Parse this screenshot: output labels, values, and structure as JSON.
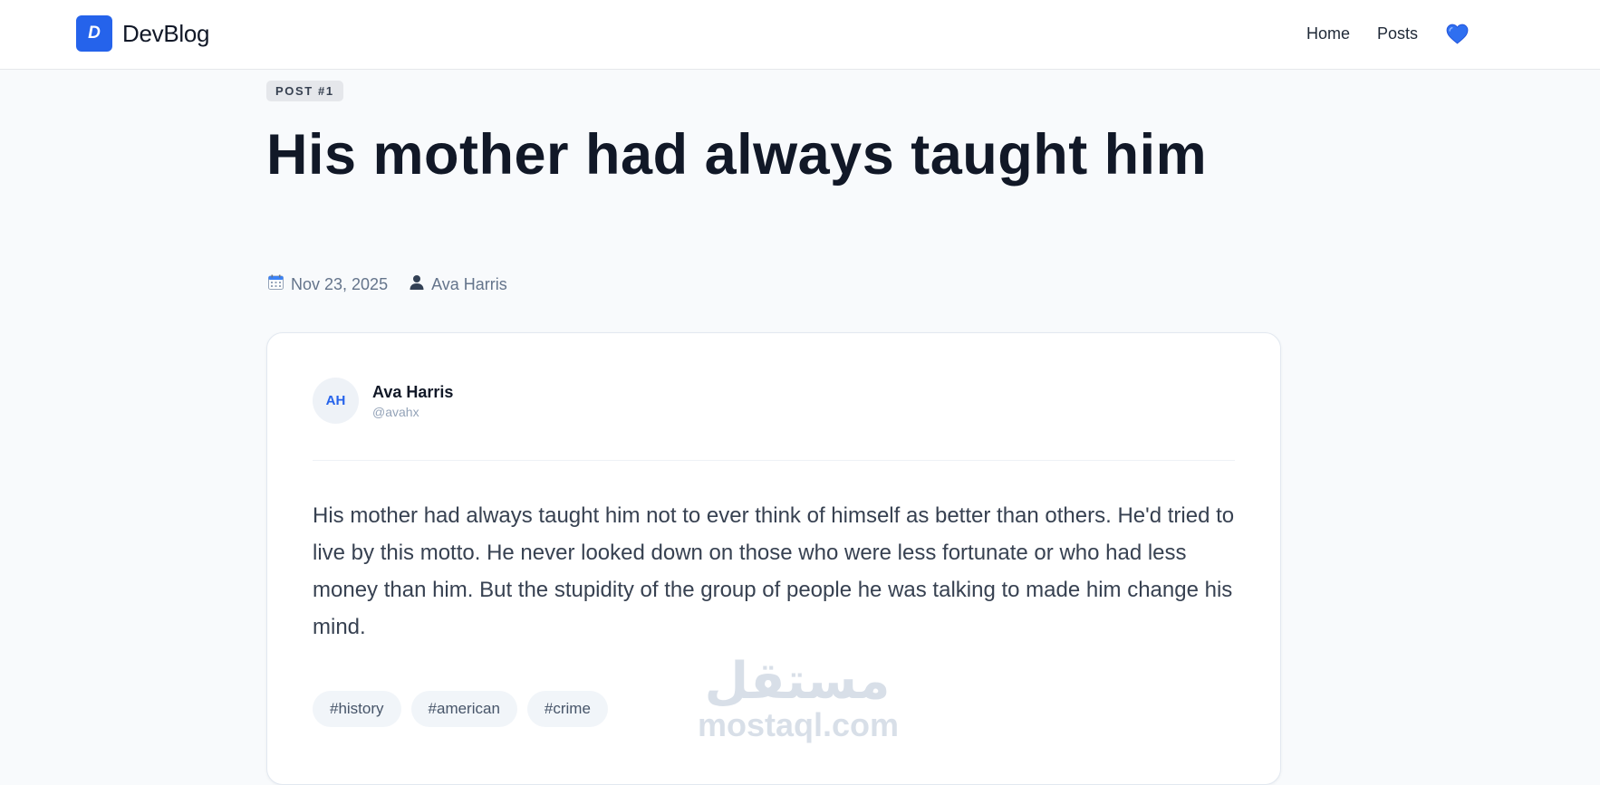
{
  "header": {
    "logo_letter": "D",
    "brand": "DevBlog",
    "nav": [
      {
        "label": "Home"
      },
      {
        "label": "Posts"
      }
    ],
    "heart_icon": "blue-heart-icon",
    "accent": "#2563eb"
  },
  "post": {
    "badge": "POST #1",
    "title": "His mother had always taught him",
    "date": "Nov 23, 2025",
    "author": "Ava Harris",
    "date_icon": "calendar-icon",
    "author_icon": "user-icon"
  },
  "card": {
    "avatar_initials": "AH",
    "author_name": "Ava Harris",
    "author_handle": "@avahx",
    "body": "His mother had always taught him not to ever think of himself as better than others. He'd tried to live by this motto. He never looked down on those who were less fortunate or who had less money than him. But the stupidity of the group of people he was talking to made him change his mind.",
    "tags": [
      "#history",
      "#american",
      "#crime"
    ]
  },
  "watermark": {
    "arabic": "مستقل",
    "latin": "mostaql.com"
  }
}
